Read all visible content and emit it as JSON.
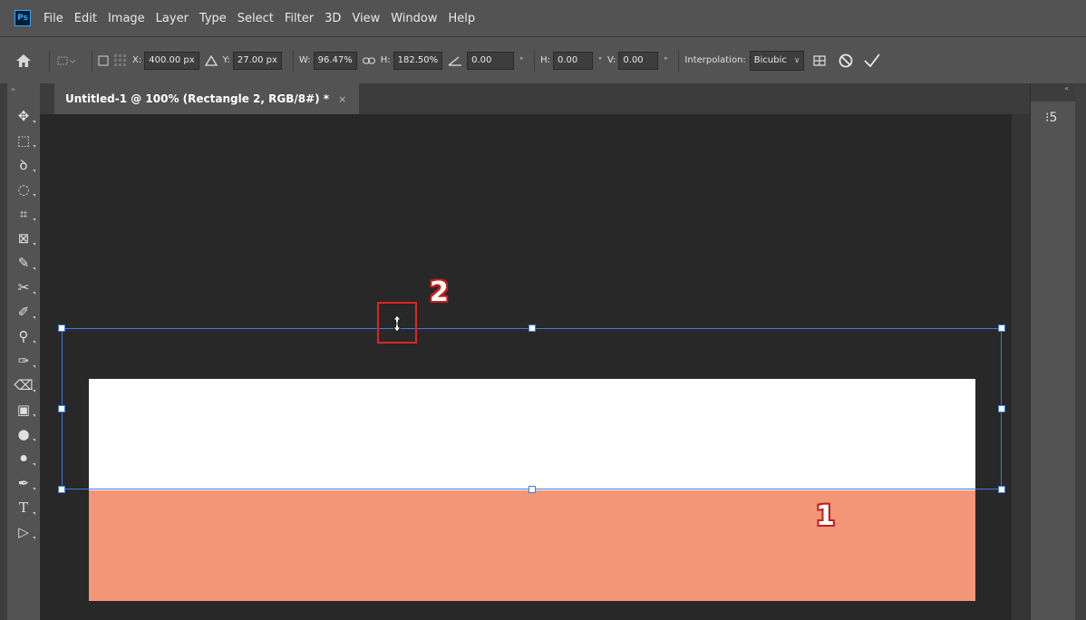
{
  "app": {
    "logo_text": "Ps",
    "accent_color": "#31a8ff"
  },
  "menu": [
    "File",
    "Edit",
    "Image",
    "Layer",
    "Type",
    "Select",
    "Filter",
    "3D",
    "View",
    "Window",
    "Help"
  ],
  "options_bar": {
    "x_label": "X:",
    "x_value": "400.00 px",
    "y_label": "Y:",
    "y_value": "27.00 px",
    "w_label": "W:",
    "w_value": "96.47%",
    "h_label": "H:",
    "h_value": "182.50%",
    "angle_value": "0.00",
    "hskew_label": "H:",
    "hskew_value": "0.00",
    "vskew_label": "V:",
    "vskew_value": "0.00",
    "degree_symbol": "°",
    "interpolation_label": "Interpolation:",
    "interpolation_value": "Bicubic"
  },
  "document_tab": {
    "title": "Untitled-1 @ 100% (Rectangle 2, RGB/8#) *",
    "close": "×"
  },
  "toolbar": {
    "collapse": "»",
    "tools": [
      {
        "name": "move-tool",
        "glyph": "✥"
      },
      {
        "name": "marquee-tool",
        "glyph": "⬚"
      },
      {
        "name": "lasso-tool",
        "glyph": "ꝺ"
      },
      {
        "name": "quick-select-tool",
        "glyph": "◌"
      },
      {
        "name": "crop-tool",
        "glyph": "⌗"
      },
      {
        "name": "frame-tool",
        "glyph": "⊠"
      },
      {
        "name": "eyedropper-tool",
        "glyph": "✎"
      },
      {
        "name": "healing-tool",
        "glyph": "✂"
      },
      {
        "name": "brush-tool",
        "glyph": "✐"
      },
      {
        "name": "stamp-tool",
        "glyph": "⚲"
      },
      {
        "name": "history-brush-tool",
        "glyph": "✑"
      },
      {
        "name": "eraser-tool",
        "glyph": "⌫"
      },
      {
        "name": "gradient-tool",
        "glyph": "▣"
      },
      {
        "name": "blur-tool",
        "glyph": "●"
      },
      {
        "name": "dodge-tool",
        "glyph": "⚫"
      },
      {
        "name": "pen-tool",
        "glyph": "✒"
      },
      {
        "name": "type-tool",
        "glyph": "T"
      },
      {
        "name": "path-select-tool",
        "glyph": "▷"
      }
    ]
  },
  "right_panel": {
    "collapse": "«",
    "history_icon": "⁝5"
  },
  "canvas": {
    "white_color": "#ffffff",
    "salmon_color": "#f29677",
    "selection_color": "#3d7be0"
  },
  "callouts": {
    "one": "1",
    "two": "2"
  }
}
